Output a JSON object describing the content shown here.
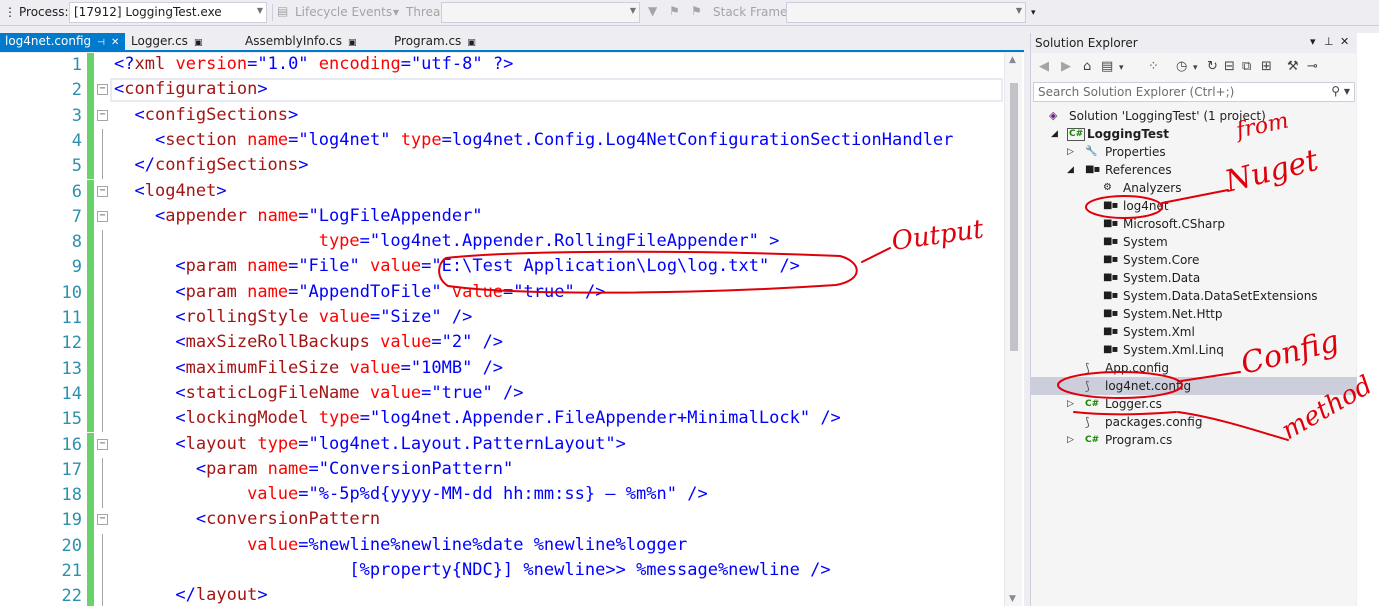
{
  "toolbar": {
    "process_label": "Process:",
    "process_value": "[17912] LoggingTest.exe",
    "lifecycle_label": "Lifecycle Events",
    "thread_label": "Thread:",
    "stack_frame_label": "Stack Frame:"
  },
  "tabs": [
    {
      "label": "log4net.config",
      "active": true
    },
    {
      "label": "Logger.cs",
      "active": false
    },
    {
      "label": "AssemblyInfo.cs",
      "active": false
    },
    {
      "label": "Program.cs",
      "active": false
    }
  ],
  "editor": {
    "lines": [
      {
        "n": "1",
        "text": "<?xml version=\"1.0\" encoding=\"utf-8\" ?>"
      },
      {
        "n": "2",
        "text": "<configuration>"
      },
      {
        "n": "3",
        "text": "  <configSections>"
      },
      {
        "n": "4",
        "text": "    <section name=\"log4net\" type=\"log4net.Config.Log4NetConfigurationSectionHandler"
      },
      {
        "n": "5",
        "text": "  </configSections>"
      },
      {
        "n": "6",
        "text": "  <log4net>"
      },
      {
        "n": "7",
        "text": "    <appender name=\"LogFileAppender\""
      },
      {
        "n": "8",
        "text": "                    type=\"log4net.Appender.RollingFileAppender\" >"
      },
      {
        "n": "9",
        "text": "      <param name=\"File\" value=\"E:\\Test Application\\Log\\log.txt\" />"
      },
      {
        "n": "10",
        "text": "      <param name=\"AppendToFile\" value=\"true\" />"
      },
      {
        "n": "11",
        "text": "      <rollingStyle value=\"Size\" />"
      },
      {
        "n": "12",
        "text": "      <maxSizeRollBackups value=\"2\" />"
      },
      {
        "n": "13",
        "text": "      <maximumFileSize value=\"10MB\" />"
      },
      {
        "n": "14",
        "text": "      <staticLogFileName value=\"true\" />"
      },
      {
        "n": "15",
        "text": "      <lockingModel type=\"log4net.Appender.FileAppender+MinimalLock\" />"
      },
      {
        "n": "16",
        "text": "      <layout type=\"log4net.Layout.PatternLayout\">"
      },
      {
        "n": "17",
        "text": "        <param name=\"ConversionPattern\""
      },
      {
        "n": "18",
        "text": "             value=\"%-5p%d{yyyy-MM-dd hh:mm:ss} – %m%n\" />"
      },
      {
        "n": "19",
        "text": "        <conversionPattern"
      },
      {
        "n": "20",
        "text": "             value=\"%newline%newline%date %newline%logger"
      },
      {
        "n": "21",
        "text": "                       [%property{NDC}] %newline>> %message%newline\" />"
      },
      {
        "n": "22",
        "text": "      </layout>"
      }
    ]
  },
  "solution_explorer": {
    "title": "Solution Explorer",
    "search_placeholder": "Search Solution Explorer (Ctrl+;)",
    "tree": [
      {
        "label": "Solution 'LoggingTest' (1 project)",
        "icon": "solution-icon"
      },
      {
        "label": "LoggingTest",
        "icon": "csharp-project-icon"
      },
      {
        "label": "Properties",
        "icon": "wrench-icon"
      },
      {
        "label": "References",
        "icon": "reference-icon"
      },
      {
        "label": "Analyzers",
        "icon": "analyzer-icon"
      },
      {
        "label": "log4net",
        "icon": "reference-icon"
      },
      {
        "label": "Microsoft.CSharp",
        "icon": "reference-icon"
      },
      {
        "label": "System",
        "icon": "reference-icon"
      },
      {
        "label": "System.Core",
        "icon": "reference-icon"
      },
      {
        "label": "System.Data",
        "icon": "reference-icon"
      },
      {
        "label": "System.Data.DataSetExtensions",
        "icon": "reference-icon"
      },
      {
        "label": "System.Net.Http",
        "icon": "reference-icon"
      },
      {
        "label": "System.Xml",
        "icon": "reference-icon"
      },
      {
        "label": "System.Xml.Linq",
        "icon": "reference-icon"
      },
      {
        "label": "App.config",
        "icon": "config-file-icon"
      },
      {
        "label": "log4net.config",
        "icon": "config-file-icon"
      },
      {
        "label": "Logger.cs",
        "icon": "csharp-file-icon"
      },
      {
        "label": "packages.config",
        "icon": "config-file-icon"
      },
      {
        "label": "Program.cs",
        "icon": "csharp-file-icon"
      }
    ]
  },
  "annotations": {
    "output": "Output",
    "from": "from",
    "nuget": "Nuget",
    "config": "Config",
    "method": "method"
  },
  "colors": {
    "accent": "#007acc",
    "annotation": "#e0000a",
    "xml_tag": "#a31515",
    "xml_attribute": "#ff0000",
    "xml_value": "#0000ff",
    "line_number": "#2b91af",
    "change_bar": "#6ad26a"
  }
}
